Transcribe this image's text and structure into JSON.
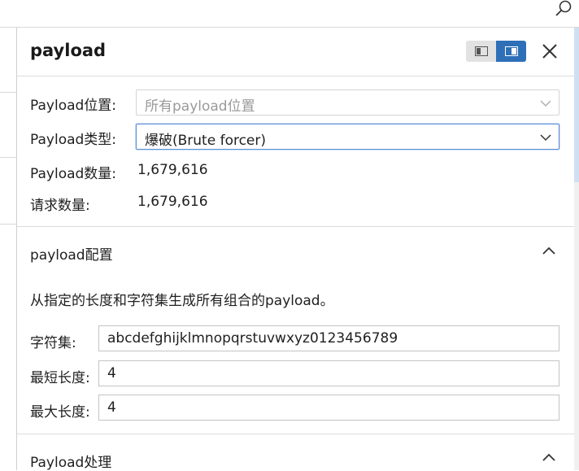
{
  "panel": {
    "title": "payload"
  },
  "fields": {
    "position_label": "Payload位置:",
    "position_placeholder": "所有payload位置",
    "type_label": "Payload类型:",
    "type_value": "爆破(Brute forcer)",
    "count_label": "Payload数量:",
    "count_value": "1,679,616",
    "requests_label": "请求数量:",
    "requests_value": "1,679,616"
  },
  "config": {
    "title": "payload配置",
    "description": "从指定的长度和字符集生成所有组合的payload。",
    "charset_label": "字符集:",
    "charset_value": "abcdefghijklmnopqrstuvwxyz0123456789",
    "min_label": "最短长度:",
    "min_value": "4",
    "max_label": "最大长度:",
    "max_value": "4"
  },
  "processing": {
    "title": "Payload处理"
  },
  "colors": {
    "accent": "#2e6fb8"
  }
}
